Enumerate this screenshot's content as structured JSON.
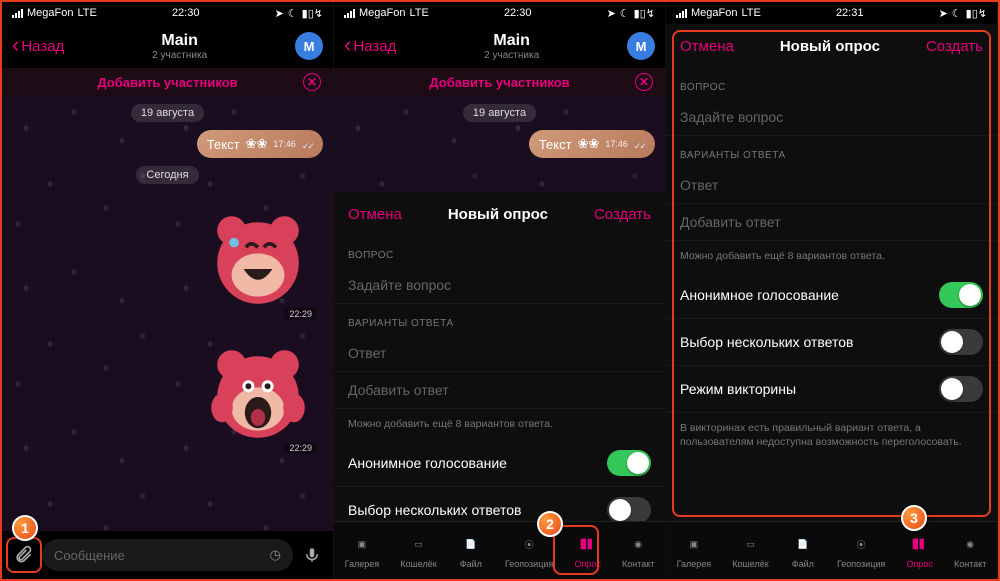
{
  "status": {
    "carrier": "MegaFon",
    "net": "LTE",
    "time1": "22:30",
    "time3": "22:31"
  },
  "header": {
    "back": "Назад",
    "title": "Main",
    "subtitle": "2 участника",
    "avatar_letter": "M",
    "add": "Добавить участников"
  },
  "chat": {
    "date1": "19 августа",
    "msg1": "Текст",
    "msg1_time": "17:46",
    "date2": "Сегодня",
    "st_time1": "22:29",
    "st_time2": "22:29"
  },
  "input": {
    "placeholder": "Сообщение"
  },
  "attach": {
    "items": [
      {
        "label": "Галерея"
      },
      {
        "label": "Кошелёк"
      },
      {
        "label": "Файл"
      },
      {
        "label": "Геопозиция"
      },
      {
        "label": "Опрос"
      },
      {
        "label": "Контакт"
      }
    ]
  },
  "poll": {
    "cancel": "Отмена",
    "title": "Новый опрос",
    "create": "Создать",
    "q_label": "ВОПРОС",
    "q_ph": "Задайте вопрос",
    "a_label": "ВАРИАНТЫ ОТВЕТА",
    "a_ph": "Ответ",
    "a_add": "Добавить ответ",
    "a_hint": "Можно добавить ещё 8 вариантов ответа.",
    "opt1": "Анонимное голосование",
    "opt2": "Выбор нескольких ответов",
    "opt3": "Режим викторины",
    "quiz_hint": "В викторинах есть правильный вариант ответа, а пользователям недоступна возможность переголосовать."
  },
  "callouts": {
    "c1": "1",
    "c2": "2",
    "c3": "3"
  }
}
